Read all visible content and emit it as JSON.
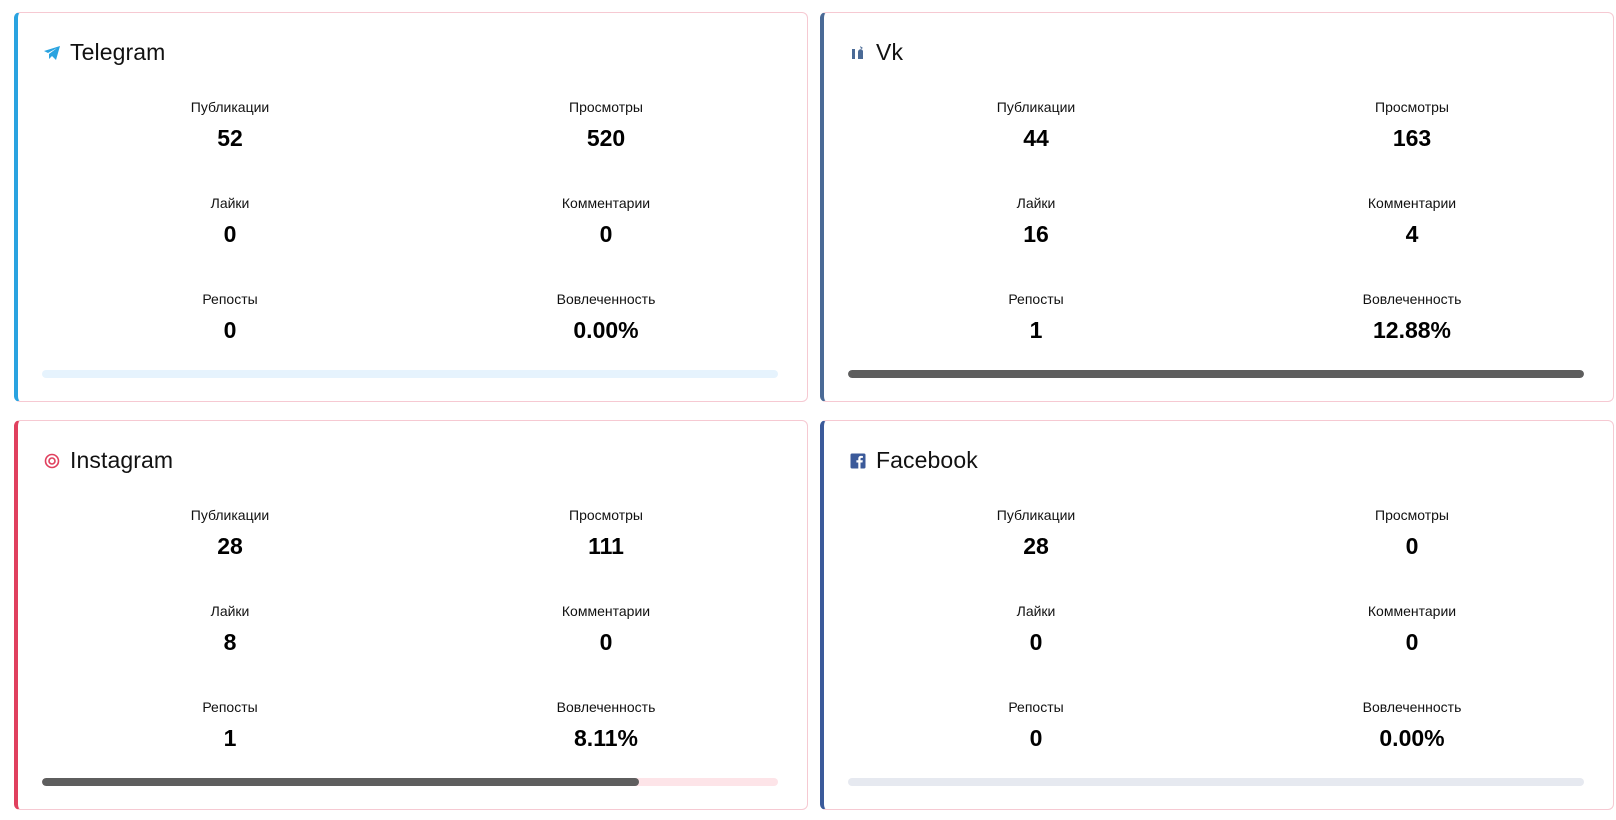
{
  "cards": [
    {
      "title": "Telegram",
      "icon": "telegram-icon",
      "accent": "#2aa3e0",
      "track": "#e6f3fd",
      "engagement_fraction": 0.0,
      "stats": [
        {
          "label": "Публикации",
          "value": "52"
        },
        {
          "label": "Просмотры",
          "value": "520"
        },
        {
          "label": "Лайки",
          "value": "0"
        },
        {
          "label": "Комментарии",
          "value": "0"
        },
        {
          "label": "Репосты",
          "value": "0"
        },
        {
          "label": "Вовлеченность",
          "value": "0.00%"
        }
      ]
    },
    {
      "title": "Vk",
      "icon": "vk-icon",
      "accent": "#4a6a96",
      "track": "#e6e9f0",
      "engagement_fraction": 1.0,
      "stats": [
        {
          "label": "Публикации",
          "value": "44"
        },
        {
          "label": "Просмотры",
          "value": "163"
        },
        {
          "label": "Лайки",
          "value": "16"
        },
        {
          "label": "Комментарии",
          "value": "4"
        },
        {
          "label": "Репосты",
          "value": "1"
        },
        {
          "label": "Вовлеченность",
          "value": "12.88%"
        }
      ]
    },
    {
      "title": "Instagram",
      "icon": "instagram-icon",
      "accent": "#e0405e",
      "track": "#fde4e8",
      "engagement_fraction": 0.811,
      "stats": [
        {
          "label": "Публикации",
          "value": "28"
        },
        {
          "label": "Просмотры",
          "value": "111"
        },
        {
          "label": "Лайки",
          "value": "8"
        },
        {
          "label": "Комментарии",
          "value": "0"
        },
        {
          "label": "Репосты",
          "value": "1"
        },
        {
          "label": "Вовлеченность",
          "value": "8.11%"
        }
      ]
    },
    {
      "title": "Facebook",
      "icon": "facebook-icon",
      "accent": "#3b5a9a",
      "track": "#e6e9f0",
      "engagement_fraction": 0.0,
      "stats": [
        {
          "label": "Публикации",
          "value": "28"
        },
        {
          "label": "Просмотры",
          "value": "0"
        },
        {
          "label": "Лайки",
          "value": "0"
        },
        {
          "label": "Комментарии",
          "value": "0"
        },
        {
          "label": "Репосты",
          "value": "0"
        },
        {
          "label": "Вовлеченность",
          "value": "0.00%"
        }
      ]
    }
  ]
}
